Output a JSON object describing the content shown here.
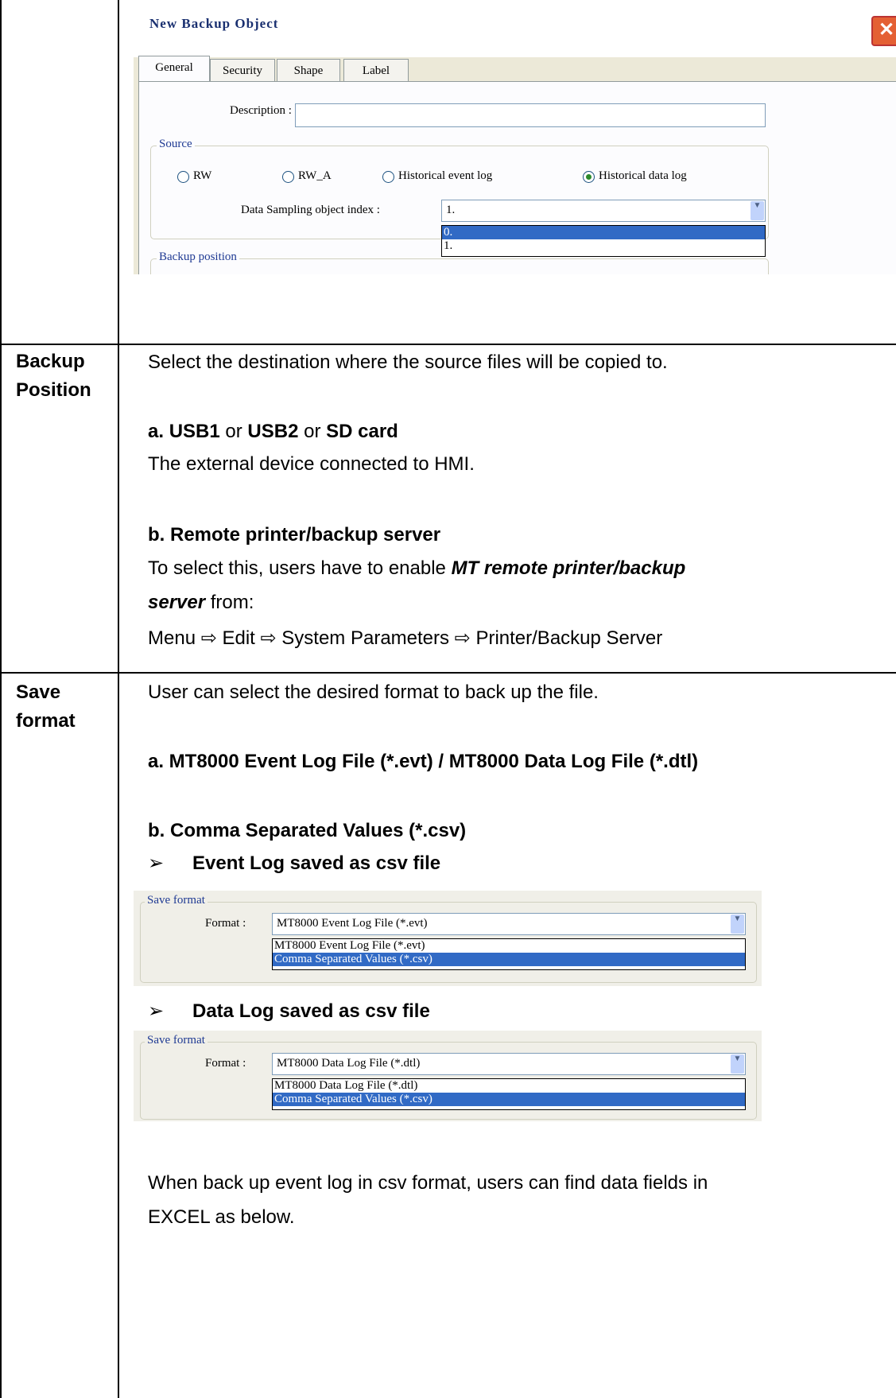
{
  "dialog": {
    "title": "New  Backup Object",
    "close_glyph": "✕",
    "tabs": [
      "General",
      "Security",
      "Shape",
      "Label"
    ],
    "description_label": "Description :",
    "description_value": "",
    "source_group": "Source",
    "radios": [
      {
        "label": "RW",
        "selected": false
      },
      {
        "label": "RW_A",
        "selected": false
      },
      {
        "label": "Historical event log",
        "selected": false
      },
      {
        "label": "Historical data log",
        "selected": true
      }
    ],
    "sampling_label": "Data Sampling object index :",
    "sampling_value": "1.",
    "sampling_options": [
      "0.",
      "1."
    ],
    "backup_position_group": "Backup position"
  },
  "rows": {
    "backup_position": {
      "label_line1": "Backup",
      "label_line2": "Position",
      "intro": "Select the destination where the source files will be copied to.",
      "a_prefix": "a.  ",
      "a_usb1": "USB1",
      "a_or1": " or ",
      "a_usb2": "USB2",
      "a_or2": " or ",
      "a_sd": "SD card",
      "a_desc": "The external device connected to HMI.",
      "b_heading": "b.  Remote printer/backup server",
      "b_desc_start": "To select this, users have to enable ",
      "b_desc_em1": "MT remote printer/backup",
      "b_desc_em2": "server",
      "b_desc_end": " from:",
      "menu_path": "Menu ⇨ Edit ⇨ System Parameters ⇨ Printer/Backup Server"
    },
    "save_format": {
      "label_line1": "Save",
      "label_line2": "format",
      "intro": "User can select the desired format to back up the file.",
      "a_heading": "a. MT8000 Event Log File (*.evt) / MT8000 Data Log File (*.dtl)",
      "b_heading": "b. Comma Separated Values (*.csv)",
      "bullet1": "Event Log saved as csv file",
      "bullet2": "Data Log saved as csv file",
      "bullet_glyph": "➢",
      "outro_line1": "When back up event log in csv format, users can find data fields in",
      "outro_line2": "EXCEL as below."
    }
  },
  "event_shot": {
    "group": "Save format",
    "format_label": "Format :",
    "value": "MT8000 Event Log File (*.evt)",
    "options": [
      "MT8000 Event Log File (*.evt)",
      "Comma Separated Values (*.csv)"
    ]
  },
  "data_shot": {
    "group": "Save format",
    "format_label": "Format :",
    "value": "MT8000 Data Log File (*.dtl)",
    "options": [
      "MT8000 Data Log File (*.dtl)",
      "Comma Separated Values (*.csv)"
    ]
  }
}
